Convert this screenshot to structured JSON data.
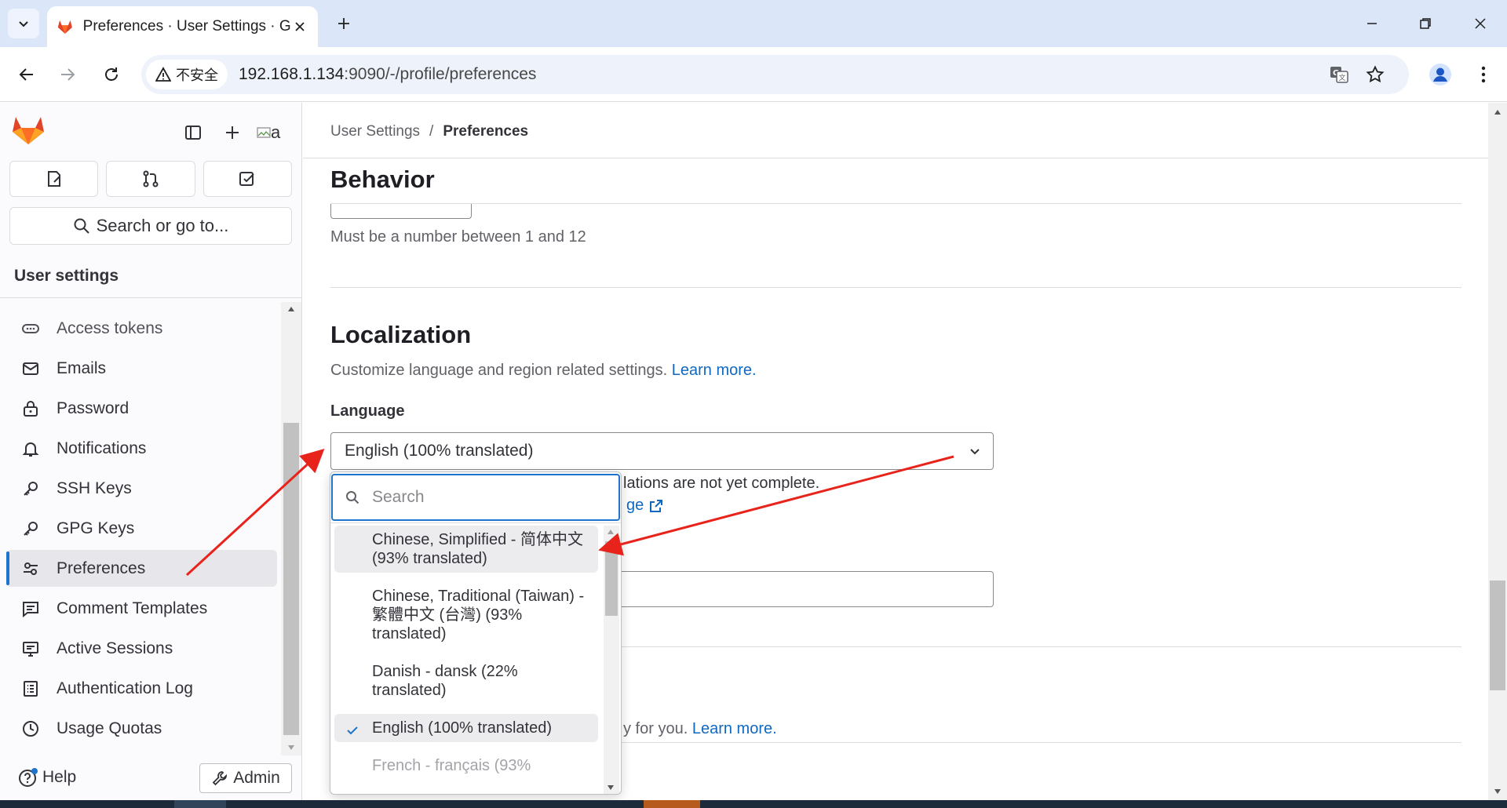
{
  "browser": {
    "tab_title": "Preferences · User Settings · GitLab",
    "security_label": "不安全",
    "url_host": "192.168.1.134",
    "url_rest": ":9090/-/profile/preferences"
  },
  "sidebar": {
    "avatar_alt": "a",
    "search_label": "Search or go to...",
    "section_title": "User settings",
    "items": [
      {
        "label": "Access tokens",
        "icon": "token-icon"
      },
      {
        "label": "Emails",
        "icon": "mail-icon"
      },
      {
        "label": "Password",
        "icon": "lock-icon"
      },
      {
        "label": "Notifications",
        "icon": "bell-icon"
      },
      {
        "label": "SSH Keys",
        "icon": "key-icon"
      },
      {
        "label": "GPG Keys",
        "icon": "key-icon"
      },
      {
        "label": "Preferences",
        "icon": "preferences-icon",
        "active": true
      },
      {
        "label": "Comment Templates",
        "icon": "comment-icon"
      },
      {
        "label": "Active Sessions",
        "icon": "monitor-icon"
      },
      {
        "label": "Authentication Log",
        "icon": "log-icon"
      },
      {
        "label": "Usage Quotas",
        "icon": "quota-icon"
      }
    ],
    "help_label": "Help",
    "admin_label": "Admin"
  },
  "main": {
    "breadcrumb": [
      "User Settings",
      "Preferences"
    ],
    "behavior_title": "Behavior",
    "number_help": "Must be a number between 1 and 12",
    "localization_title": "Localization",
    "localization_desc": "Customize language and region related settings.",
    "learn_more": "Learn more.",
    "language_label": "Language",
    "language_value": "English (100% translated)",
    "under_text": "lations are not yet complete.",
    "under_link": "ge",
    "bottom_desc_tail": "y for you.",
    "bottom_learn_more": "Learn more."
  },
  "dropdown": {
    "search_placeholder": "Search",
    "options": [
      {
        "label": "Chinese, Simplified - 简体中文 (93% translated)",
        "state": "hover"
      },
      {
        "label": "Chinese, Traditional (Taiwan) - 繁體中文 (台灣) (93% translated)",
        "state": ""
      },
      {
        "label": "Danish - dansk (22% translated)",
        "state": ""
      },
      {
        "label": "English (100% translated)",
        "state": "selected"
      },
      {
        "label": "French - français (93%",
        "state": "faded"
      }
    ]
  },
  "colors": {
    "accent": "#1f75cb",
    "link": "#1068bf",
    "annotation_arrow": "#e8231b",
    "gitlab_orange": "#e24329"
  }
}
